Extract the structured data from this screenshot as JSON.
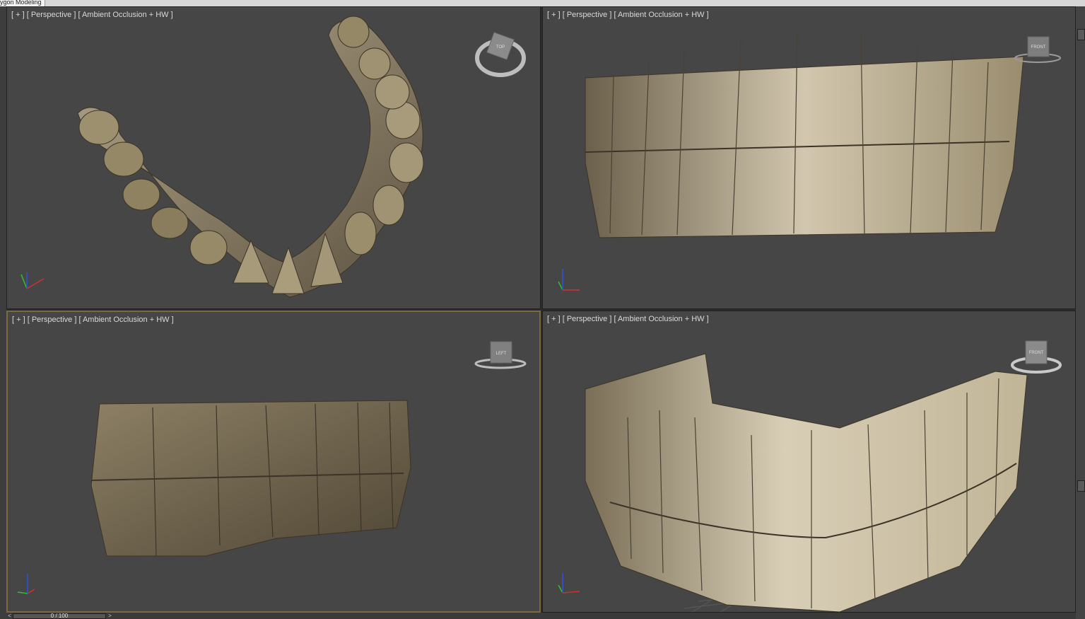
{
  "window": {
    "title_tab": "ygon Modeling"
  },
  "viewports": [
    {
      "id": "top-left",
      "label": "[ + ] [ Perspective ] [ Ambient Occlusion + HW ]",
      "viewcube_face": "TOP",
      "active": false
    },
    {
      "id": "top-right",
      "label": "[ + ] [ Perspective ] [ Ambient Occlusion + HW ]",
      "viewcube_face": "FRONT",
      "active": false
    },
    {
      "id": "bottom-left",
      "label": "[ + ] [ Perspective ] [ Ambient Occlusion + HW ]",
      "viewcube_face": "LEFT",
      "active": true
    },
    {
      "id": "bottom-right",
      "label": "[ + ] [ Perspective ] [ Ambient Occlusion + HW ]",
      "viewcube_face": "FRONT",
      "active": false
    }
  ],
  "timeline": {
    "frame_display": "0 / 100",
    "prev_label": "<",
    "next_label": ">"
  },
  "colors": {
    "viewport_bg": "#464646",
    "tooth_light": "#d8cdb5",
    "tooth_mid": "#a8987a",
    "tooth_dark": "#5e533f",
    "active_border": "#7b6a3e",
    "axis_x": "#d03030",
    "axis_y": "#30c030",
    "axis_z": "#3050e0"
  },
  "icons": {
    "viewcube": "viewcube-icon",
    "axis_tripod": "axis-tripod-icon"
  }
}
